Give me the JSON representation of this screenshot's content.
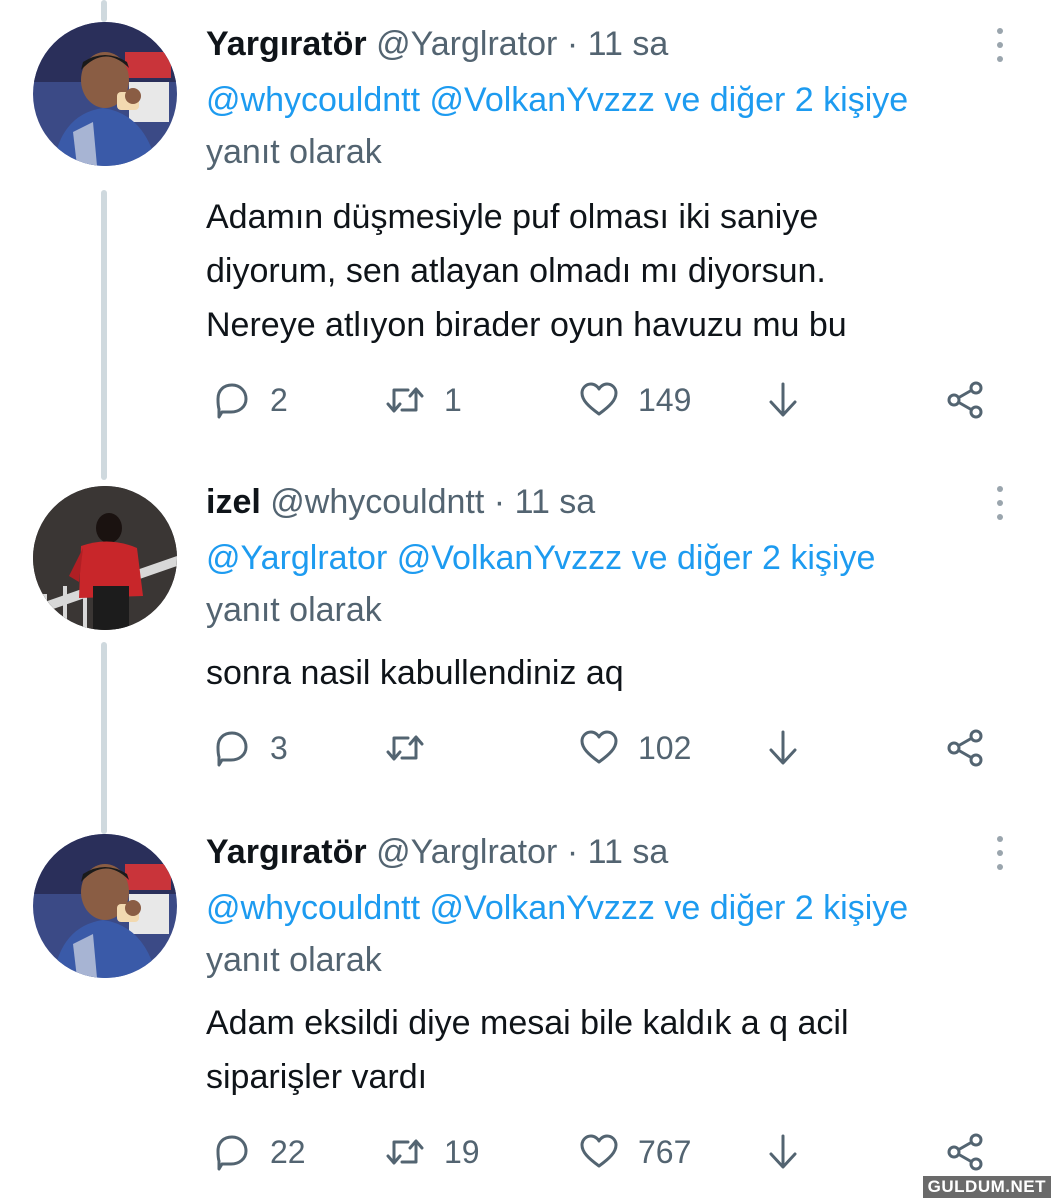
{
  "tweets": [
    {
      "name": "Yargıratör",
      "handle": "@Yarglrator",
      "dot": "·",
      "time": "11 sa",
      "reply_mention_1": "@whycouldntt",
      "reply_mention_2": "@VolkanYvzzz",
      "reply_suffix": "ve diğer 2 kişiye",
      "reply_label": "yanıt olarak",
      "text_lines": [
        "Adamın düşmesiyle puf olması iki saniye",
        "diyorum, sen atlayan olmadı mı diyorsun.",
        "Nereye atlıyon birader oyun havuzu mu bu"
      ],
      "replies": "2",
      "retweets": "1",
      "likes": "149"
    },
    {
      "name": "izel",
      "handle": "@whycouldntt",
      "dot": "·",
      "time": "11 sa",
      "reply_mention_1": "@Yarglrator",
      "reply_mention_2": "@VolkanYvzzz",
      "reply_suffix": "ve diğer 2 kişiye",
      "reply_label": "yanıt olarak",
      "text_lines": [
        "sonra nasil kabullendiniz aq"
      ],
      "replies": "3",
      "retweets": "",
      "likes": "102"
    },
    {
      "name": "Yargıratör",
      "handle": "@Yarglrator",
      "dot": "·",
      "time": "11 sa",
      "reply_mention_1": "@whycouldntt",
      "reply_mention_2": "@VolkanYvzzz",
      "reply_suffix": "ve diğer 2 kişiye",
      "reply_label": "yanıt olarak",
      "text_lines": [
        "Adam eksildi diye mesai bile kaldık a q acil",
        "siparişler vardı"
      ],
      "replies": "22",
      "retweets": "19",
      "likes": "767"
    }
  ],
  "icons": {
    "reply": "reply-icon",
    "retweet": "retweet-icon",
    "like": "heart-icon",
    "download": "download-icon",
    "share": "share-icon",
    "more": "more-vertical-icon"
  },
  "colors": {
    "mention": "#1d9bf0",
    "secondary_text": "#536471",
    "thread_line": "#cfd9de"
  },
  "watermark": "GULDUM.NET"
}
